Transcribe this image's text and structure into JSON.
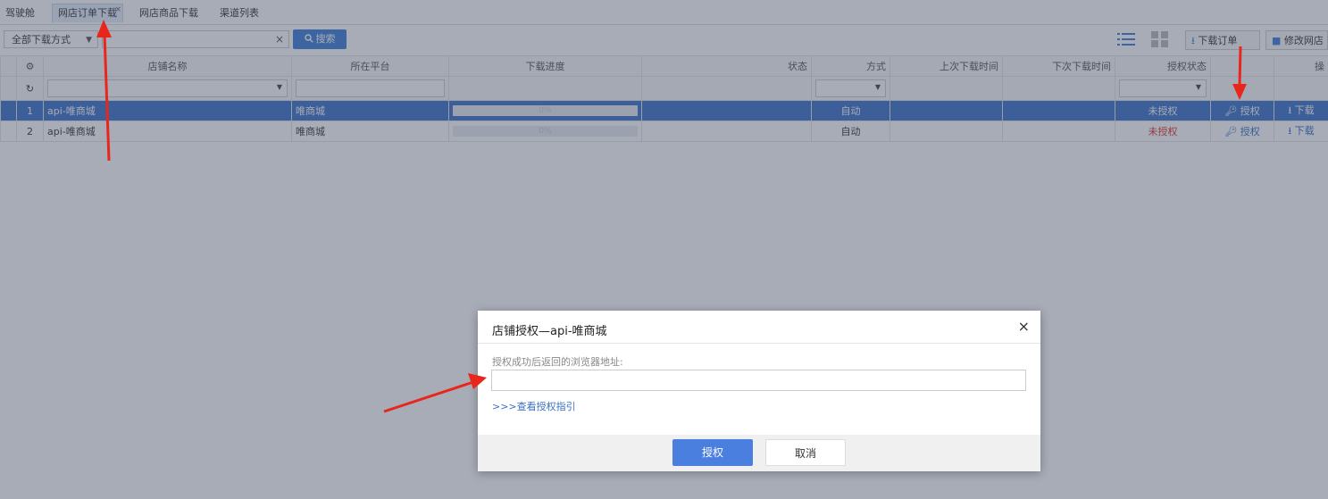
{
  "tabs": [
    {
      "label": "驾驶舱"
    },
    {
      "label": "网店订单下载",
      "close": "×"
    },
    {
      "label": "网店商品下载"
    },
    {
      "label": "渠道列表"
    }
  ],
  "toolbar": {
    "mode_select": "全部下载方式",
    "search_label": "搜索",
    "clear_icon": "×",
    "download_orders": "下载订单",
    "modify_shop": "修改网店"
  },
  "grid": {
    "columns": [
      "店铺名称",
      "所在平台",
      "下载进度",
      "状态",
      "方式",
      "上次下载时间",
      "下次下载时间",
      "授权状态",
      "",
      "操"
    ],
    "rows": [
      {
        "index": "1",
        "name": "api-唯商城",
        "platform": "唯商城",
        "progress": "0%",
        "mode": "自动",
        "auth_status": "未授权",
        "authorize": "授权",
        "download": "下载"
      },
      {
        "index": "2",
        "name": "api-唯商城",
        "platform": "唯商城",
        "progress": "0%",
        "mode": "自动",
        "auth_status": "未授权",
        "authorize": "授权",
        "download": "下载"
      }
    ]
  },
  "dialog": {
    "title": "店铺授权—api-唯商城",
    "close": "×",
    "field_label": "授权成功后返回的浏览器地址:",
    "field_value": "",
    "guide_link": ">>>查看授权指引",
    "ok_label": "授权",
    "cancel_label": "取消"
  },
  "colors": {
    "primary": "#3f7fd8",
    "selected_row": "#3d73c9",
    "unauthorized": "#e0312c",
    "annotation_arrow": "#e8261c"
  }
}
